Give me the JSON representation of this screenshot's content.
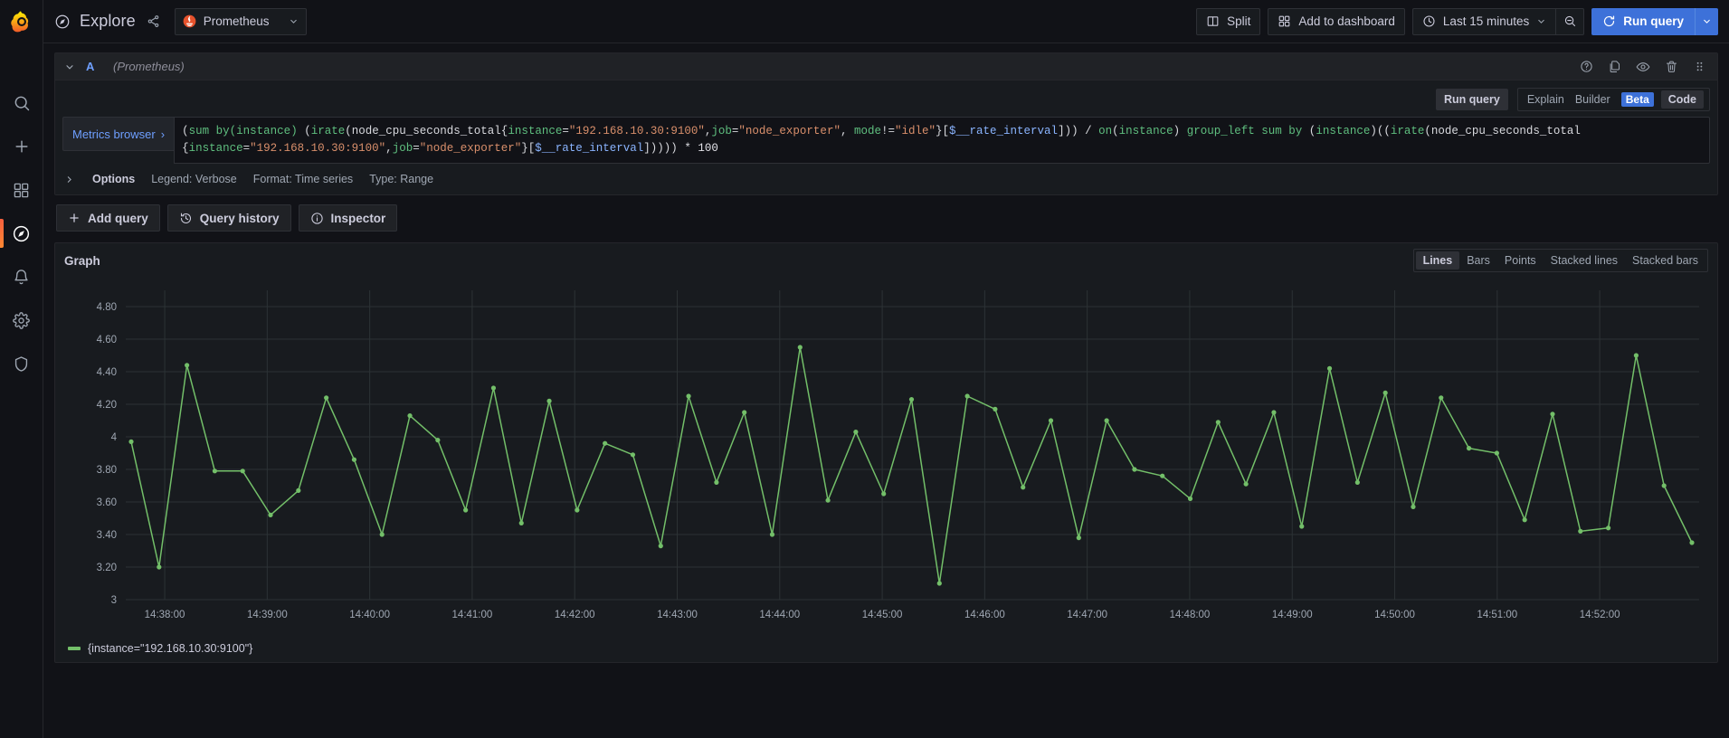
{
  "sidebar": {
    "logo": "grafana-logo",
    "items": [
      {
        "name": "search",
        "icon": "search-icon",
        "active": false
      },
      {
        "name": "create",
        "icon": "plus-icon",
        "active": false
      },
      {
        "name": "dashboards",
        "icon": "apps-grid-icon",
        "active": false
      },
      {
        "name": "explore",
        "icon": "compass-icon",
        "active": true
      },
      {
        "name": "alerting",
        "icon": "bell-icon",
        "active": false
      },
      {
        "name": "configuration",
        "icon": "gear-icon",
        "active": false
      },
      {
        "name": "server-admin",
        "icon": "shield-icon",
        "active": false
      }
    ]
  },
  "topbar": {
    "title": "Explore",
    "share_icon": "share-nodes-icon",
    "datasource": {
      "name": "Prometheus",
      "icon": "prometheus-logo",
      "caret": "⌄"
    },
    "split_label": "Split",
    "add_to_dashboard_label": "Add to dashboard",
    "time_range_label": "Last 15 minutes",
    "zoom_out_icon": "magnifier-minus-icon",
    "run_query_label": "Run query",
    "run_query_caret": "⌄"
  },
  "query": {
    "ref_id": "A",
    "datasource_note": "(Prometheus)",
    "chevron": "⌄",
    "header_icons": [
      "help-circle-icon",
      "copy-icon",
      "eye-icon",
      "trash-icon",
      "drag-handle-icon"
    ],
    "run_query_label": "Run query",
    "explain_label": "Explain",
    "builder_label": "Builder",
    "beta_label": "Beta",
    "code_label": "Code",
    "metrics_browser_label": "Metrics browser",
    "metrics_browser_chevron": "›",
    "expression": "(sum by(instance) (irate(node_cpu_seconds_total{instance=\"192.168.10.30:9100\",job=\"node_exporter\", mode!=\"idle\"}[$__rate_interval])) / on(instance) group_left sum by (instance)((irate(node_cpu_seconds_total{instance=\"192.168.10.30:9100\",job=\"node_exporter\"}[$__rate_interval])))) * 100",
    "options": {
      "chevron": "›",
      "label": "Options",
      "legend": "Legend: Verbose",
      "format": "Format: Time series",
      "type": "Type: Range"
    }
  },
  "actions": {
    "add_query_label": "Add query",
    "add_query_icon": "plus-icon",
    "query_history_label": "Query history",
    "query_history_icon": "history-icon",
    "inspector_label": "Inspector",
    "inspector_icon": "info-circle-icon"
  },
  "graph": {
    "title": "Graph",
    "viz_options": [
      "Lines",
      "Bars",
      "Points",
      "Stacked lines",
      "Stacked bars"
    ],
    "viz_selected": "Lines",
    "legend": [
      {
        "label": "{instance=\"192.168.10.30:9100\"}",
        "color": "#73bf69"
      }
    ]
  },
  "colors": {
    "accent_blue": "#3d71d9",
    "series_green": "#73bf69",
    "brand_orange": "#f55f3e",
    "panel_bg": "#181b1f",
    "page_bg": "#111217",
    "border": "#2e3036"
  },
  "chart_data": {
    "type": "line",
    "title": "Graph",
    "xlabel": "",
    "ylabel": "",
    "ylim": [
      3.0,
      4.9
    ],
    "grid": true,
    "legend_position": "bottom",
    "y_ticks": [
      "3",
      "3.20",
      "3.40",
      "3.60",
      "3.80",
      "4",
      "4.20",
      "4.40",
      "4.60",
      "4.80"
    ],
    "y_tick_values": [
      3,
      3.2,
      3.4,
      3.6,
      3.8,
      4,
      4.2,
      4.4,
      4.6,
      4.8
    ],
    "x_ticks": [
      "14:38:00",
      "14:39:00",
      "14:40:00",
      "14:41:00",
      "14:42:00",
      "14:43:00",
      "14:44:00",
      "14:45:00",
      "14:46:00",
      "14:47:00",
      "14:48:00",
      "14:49:00",
      "14:50:00",
      "14:51:00",
      "14:52:00"
    ],
    "x_start": "14:37:40",
    "x_end": "14:52:40",
    "series": [
      {
        "name": "{instance=\"192.168.10.30:9100\"}",
        "color": "#73bf69",
        "unit": "percent",
        "values": [
          3.97,
          3.2,
          4.44,
          3.79,
          3.79,
          3.52,
          3.67,
          4.24,
          3.86,
          3.4,
          4.13,
          3.98,
          3.55,
          4.3,
          3.47,
          4.22,
          3.55,
          3.96,
          3.89,
          3.33,
          4.25,
          3.72,
          4.15,
          3.4,
          4.55,
          3.61,
          4.03,
          3.65,
          4.23,
          3.1,
          4.25,
          4.17,
          3.69,
          4.1,
          3.38,
          4.1,
          3.8,
          3.76,
          3.62,
          4.09,
          3.71,
          4.15,
          3.45,
          4.42,
          3.72,
          4.27,
          3.57,
          4.24,
          3.93,
          3.9,
          3.49,
          4.14,
          3.42,
          3.44,
          4.5,
          3.7,
          3.35
        ]
      }
    ]
  }
}
